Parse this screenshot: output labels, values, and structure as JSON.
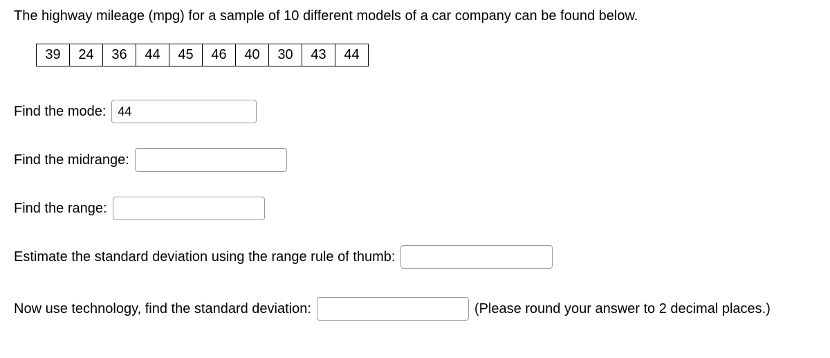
{
  "intro": "The highway mileage (mpg) for a sample of 10 different models of a car company can be found below.",
  "data_values": [
    "39",
    "24",
    "36",
    "44",
    "45",
    "46",
    "40",
    "30",
    "43",
    "44"
  ],
  "questions": {
    "mode": {
      "label": "Find the mode:",
      "value": "44"
    },
    "midrange": {
      "label": "Find the midrange:",
      "value": ""
    },
    "range": {
      "label": "Find the range:",
      "value": ""
    },
    "estimate": {
      "label": "Estimate the standard deviation using the range rule of thumb:",
      "value": ""
    },
    "stddev": {
      "label_before": "Now use technology, find the standard deviation:",
      "value": "",
      "label_after": "(Please round your answer to 2 decimal places.)"
    }
  }
}
